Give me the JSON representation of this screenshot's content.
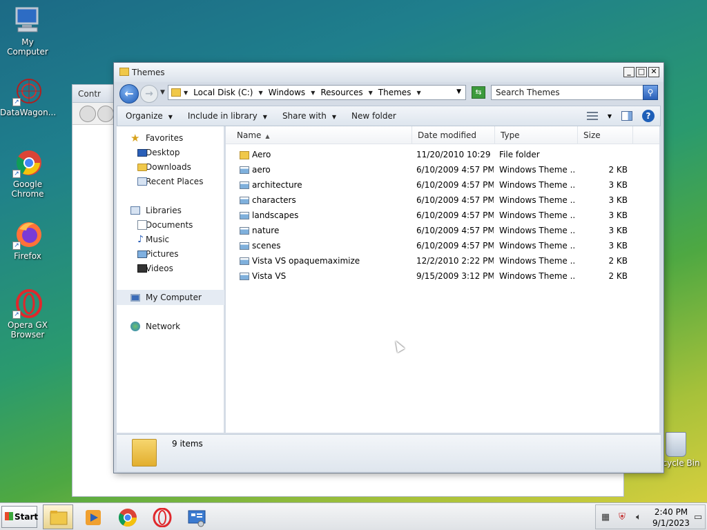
{
  "desktop": {
    "icons": [
      {
        "label": "My Computer"
      },
      {
        "label": "DataWagon..."
      },
      {
        "label": "Google Chrome"
      },
      {
        "label": "Firefox"
      },
      {
        "label": "Opera GX Browser"
      }
    ],
    "recycle_label": "Recycle Bin"
  },
  "background_window": {
    "title": "Contr"
  },
  "window": {
    "title": "Themes",
    "breadcrumb": [
      "Local Disk (C:)",
      "Windows",
      "Resources",
      "Themes"
    ],
    "search_placeholder": "Search Themes",
    "toolbar": {
      "organize": "Organize",
      "include": "Include in library",
      "share": "Share with",
      "new_folder": "New folder"
    },
    "nav": {
      "favorites": "Favorites",
      "desktop": "Desktop",
      "downloads": "Downloads",
      "recent": "Recent Places",
      "libraries": "Libraries",
      "documents": "Documents",
      "music": "Music",
      "pictures": "Pictures",
      "videos": "Videos",
      "computer": "My Computer",
      "network": "Network"
    },
    "columns": {
      "name": "Name",
      "date": "Date modified",
      "type": "Type",
      "size": "Size"
    },
    "files": [
      {
        "name": "Aero",
        "date": "11/20/2010 10:29 ...",
        "type": "File folder",
        "size": "",
        "kind": "folder"
      },
      {
        "name": "aero",
        "date": "6/10/2009 4:57 PM",
        "type": "Windows Theme ...",
        "size": "2 KB",
        "kind": "theme"
      },
      {
        "name": "architecture",
        "date": "6/10/2009 4:57 PM",
        "type": "Windows Theme ...",
        "size": "3 KB",
        "kind": "theme"
      },
      {
        "name": "characters",
        "date": "6/10/2009 4:57 PM",
        "type": "Windows Theme ...",
        "size": "3 KB",
        "kind": "theme"
      },
      {
        "name": "landscapes",
        "date": "6/10/2009 4:57 PM",
        "type": "Windows Theme ...",
        "size": "3 KB",
        "kind": "theme"
      },
      {
        "name": "nature",
        "date": "6/10/2009 4:57 PM",
        "type": "Windows Theme ...",
        "size": "3 KB",
        "kind": "theme"
      },
      {
        "name": "scenes",
        "date": "6/10/2009 4:57 PM",
        "type": "Windows Theme ...",
        "size": "3 KB",
        "kind": "theme"
      },
      {
        "name": "Vista VS opaquemaximize",
        "date": "12/2/2010 2:22 PM",
        "type": "Windows Theme ...",
        "size": "2 KB",
        "kind": "theme"
      },
      {
        "name": "Vista VS",
        "date": "9/15/2009 3:12 PM",
        "type": "Windows Theme ...",
        "size": "2 KB",
        "kind": "theme"
      }
    ],
    "status": "9 items"
  },
  "taskbar": {
    "start": "Start",
    "time": "2:40 PM",
    "date": "9/1/2023"
  }
}
